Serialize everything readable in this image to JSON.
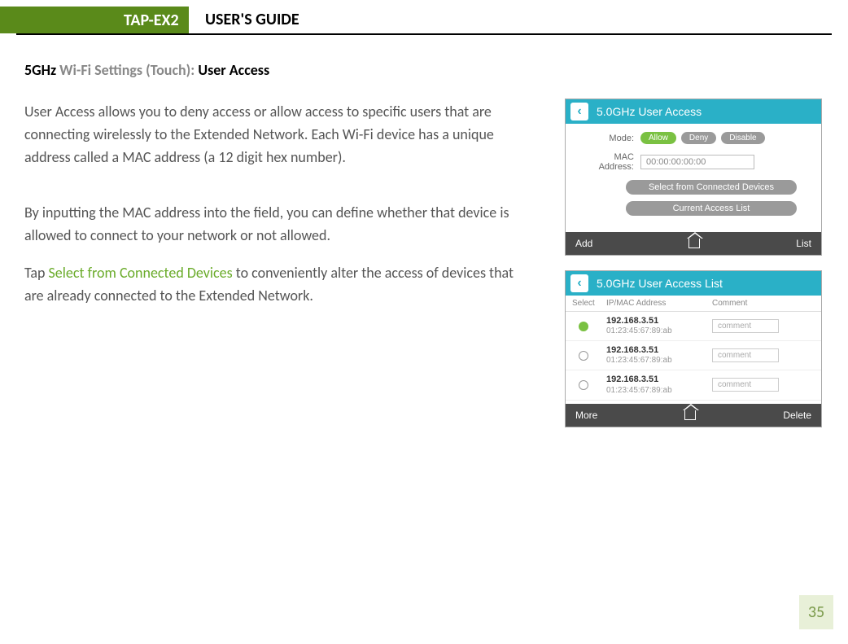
{
  "header": {
    "product": "TAP-EX2",
    "title": "USER'S GUIDE"
  },
  "section": {
    "heading_prefix": "5GHz",
    "heading_gray": " Wi-Fi Settings (Touch): ",
    "heading_suffix": "User Access"
  },
  "paragraphs": {
    "p1": "User Access allows you to deny access or allow access to specific users that are connecting wirelessly to the Extended Network. Each Wi-Fi device has a unique address called a MAC address (a 12 digit hex number).",
    "p2": "By inputting the MAC address into the field, you can define whether that device is allowed to connect to your network or not allowed.",
    "p3_a": "Tap ",
    "p3_link": "Select from Connected Devices",
    "p3_b": " to conveniently alter the access of devices that are already connected to the Extended Network."
  },
  "page_number": "35",
  "screenshot1": {
    "title": "5.0GHz User Access",
    "mode_label": "Mode:",
    "mode_allow": "Allow",
    "mode_deny": "Deny",
    "mode_disable": "Disable",
    "mac_label": "MAC Address:",
    "mac_value": "00:00:00:00:00",
    "btn_select": "Select from Connected Devices",
    "btn_current": "Current Access List",
    "bottom_left": "Add",
    "bottom_right": "List"
  },
  "screenshot2": {
    "title": "5.0GHz User Access List",
    "col_select": "Select",
    "col_ip": "IP/MAC Address",
    "col_comment": "Comment",
    "rows": [
      {
        "selected": true,
        "ip": "192.168.3.51",
        "mac": "01:23:45:67:89:ab",
        "comment": "comment"
      },
      {
        "selected": false,
        "ip": "192.168.3.51",
        "mac": "01:23:45:67:89:ab",
        "comment": "comment"
      },
      {
        "selected": false,
        "ip": "192.168.3.51",
        "mac": "01:23:45:67:89:ab",
        "comment": "comment"
      }
    ],
    "bottom_left": "More",
    "bottom_right": "Delete"
  }
}
